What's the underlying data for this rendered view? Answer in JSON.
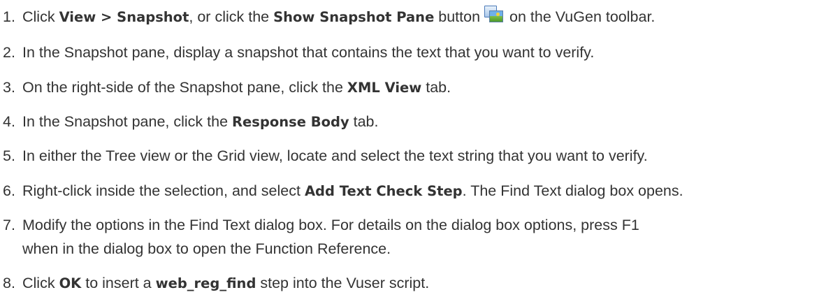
{
  "steps": [
    {
      "num": "1.",
      "t1": "Click ",
      "b1": "View > Snapshot",
      "t2": ", or click the ",
      "b2": "Show Snapshot Pane",
      "t3": " button",
      "icon": "show-snapshot-pane-icon",
      "t4": " on the VuGen toolbar."
    },
    {
      "num": "2.",
      "t1": "In the Snapshot pane, display a snapshot that contains the text that you want to verify."
    },
    {
      "num": "3.",
      "t1": "On the right-side of the Snapshot pane, click the ",
      "b1": "XML View",
      "t2": " tab."
    },
    {
      "num": "4.",
      "t1": "In the Snapshot pane, click the ",
      "b1": "Response Body",
      "t2": " tab."
    },
    {
      "num": "5.",
      "t1": "In either the Tree view or the Grid view, locate and select the text string that you want to verify."
    },
    {
      "num": "6.",
      "t1": "Right-click inside the selection, and select ",
      "b1": "Add Text Check Step",
      "t2": ". The Find Text dialog box opens."
    },
    {
      "num": "7.",
      "line1": "Modify the options in the Find Text dialog box. For details on the dialog box options, press F1",
      "line2": "when in the dialog box to open the Function Reference."
    },
    {
      "num": "8.",
      "t1": "Click ",
      "b1": "OK",
      "t2": " to insert a ",
      "b2": "web_reg_find",
      "t3": " step into the Vuser script."
    }
  ]
}
